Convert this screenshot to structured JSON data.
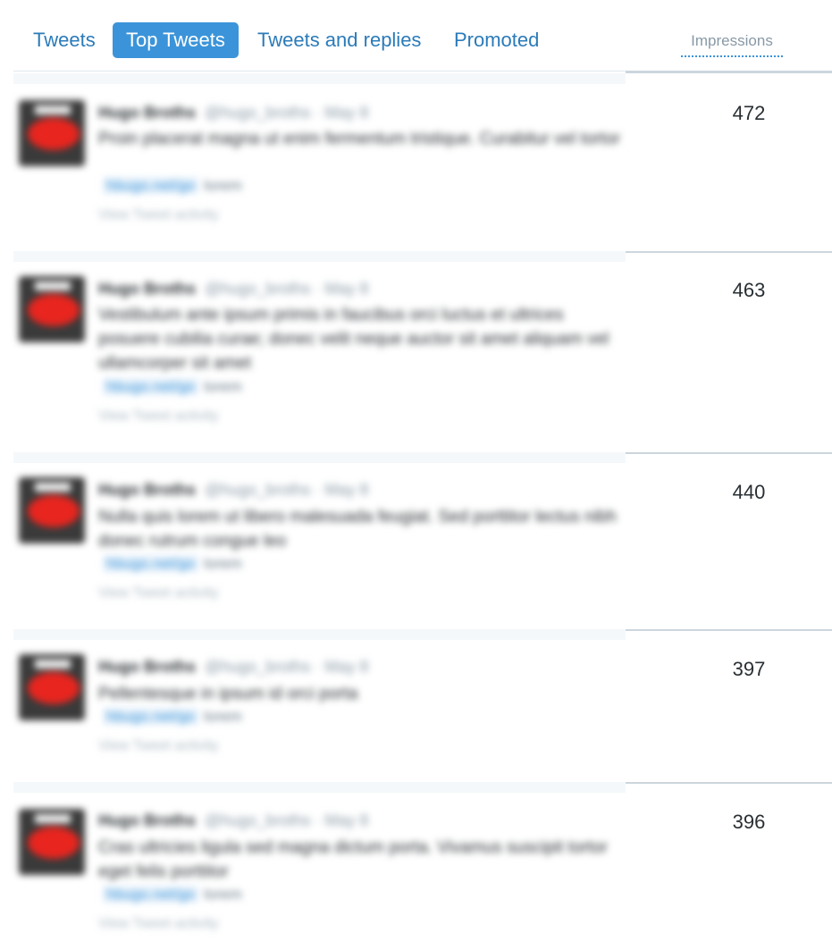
{
  "tabs": [
    {
      "label": "Tweets",
      "active": false
    },
    {
      "label": "Top Tweets",
      "active": true
    },
    {
      "label": "Tweets and replies",
      "active": false
    },
    {
      "label": "Promoted",
      "active": false
    }
  ],
  "columns": {
    "impressions": "Impressions"
  },
  "colors": {
    "accent": "#3b94d9",
    "tab_text": "#2b7bb9",
    "divider": "#ccd6dd"
  },
  "tweets": [
    {
      "name": "Hugo Broths",
      "handle": "@hugo_broths · May 8",
      "text": "Proin placerat magna ut enim fermentum tristique. Curabitur vel tortor",
      "link": "hbugo.net/go",
      "link_tail": "lorem",
      "activity": "View Tweet activity",
      "impressions": "472"
    },
    {
      "name": "Hugo Broths",
      "handle": "@hugo_broths · May 8",
      "text": "Vestibulum ante ipsum primis in faucibus orci luctus et ultrices posuere cubilia curae; donec velit neque auctor sit amet aliquam vel ullamcorper sit amet",
      "link": "hbugo.net/go",
      "link_tail": "lorem",
      "activity": "View Tweet activity",
      "impressions": "463"
    },
    {
      "name": "Hugo Broths",
      "handle": "@hugo_broths · May 8",
      "text": "Nulla quis lorem ut libero malesuada feugiat. Sed porttitor lectus nibh donec rutrum congue leo",
      "link": "hbugo.net/go",
      "link_tail": "lorem",
      "activity": "View Tweet activity",
      "impressions": "440"
    },
    {
      "name": "Hugo Broths",
      "handle": "@hugo_broths · May 8",
      "text": "Pellentesque in ipsum id orci porta",
      "link": "hbugo.net/go",
      "link_tail": "lorem",
      "activity": "View Tweet activity",
      "impressions": "397"
    },
    {
      "name": "Hugo Broths",
      "handle": "@hugo_broths · May 8",
      "text": "Cras ultricies ligula sed magna dictum porta. Vivamus suscipit tortor eget felis porttitor",
      "link": "hbugo.net/go",
      "link_tail": "lorem",
      "activity": "View Tweet activity",
      "impressions": "396"
    }
  ]
}
